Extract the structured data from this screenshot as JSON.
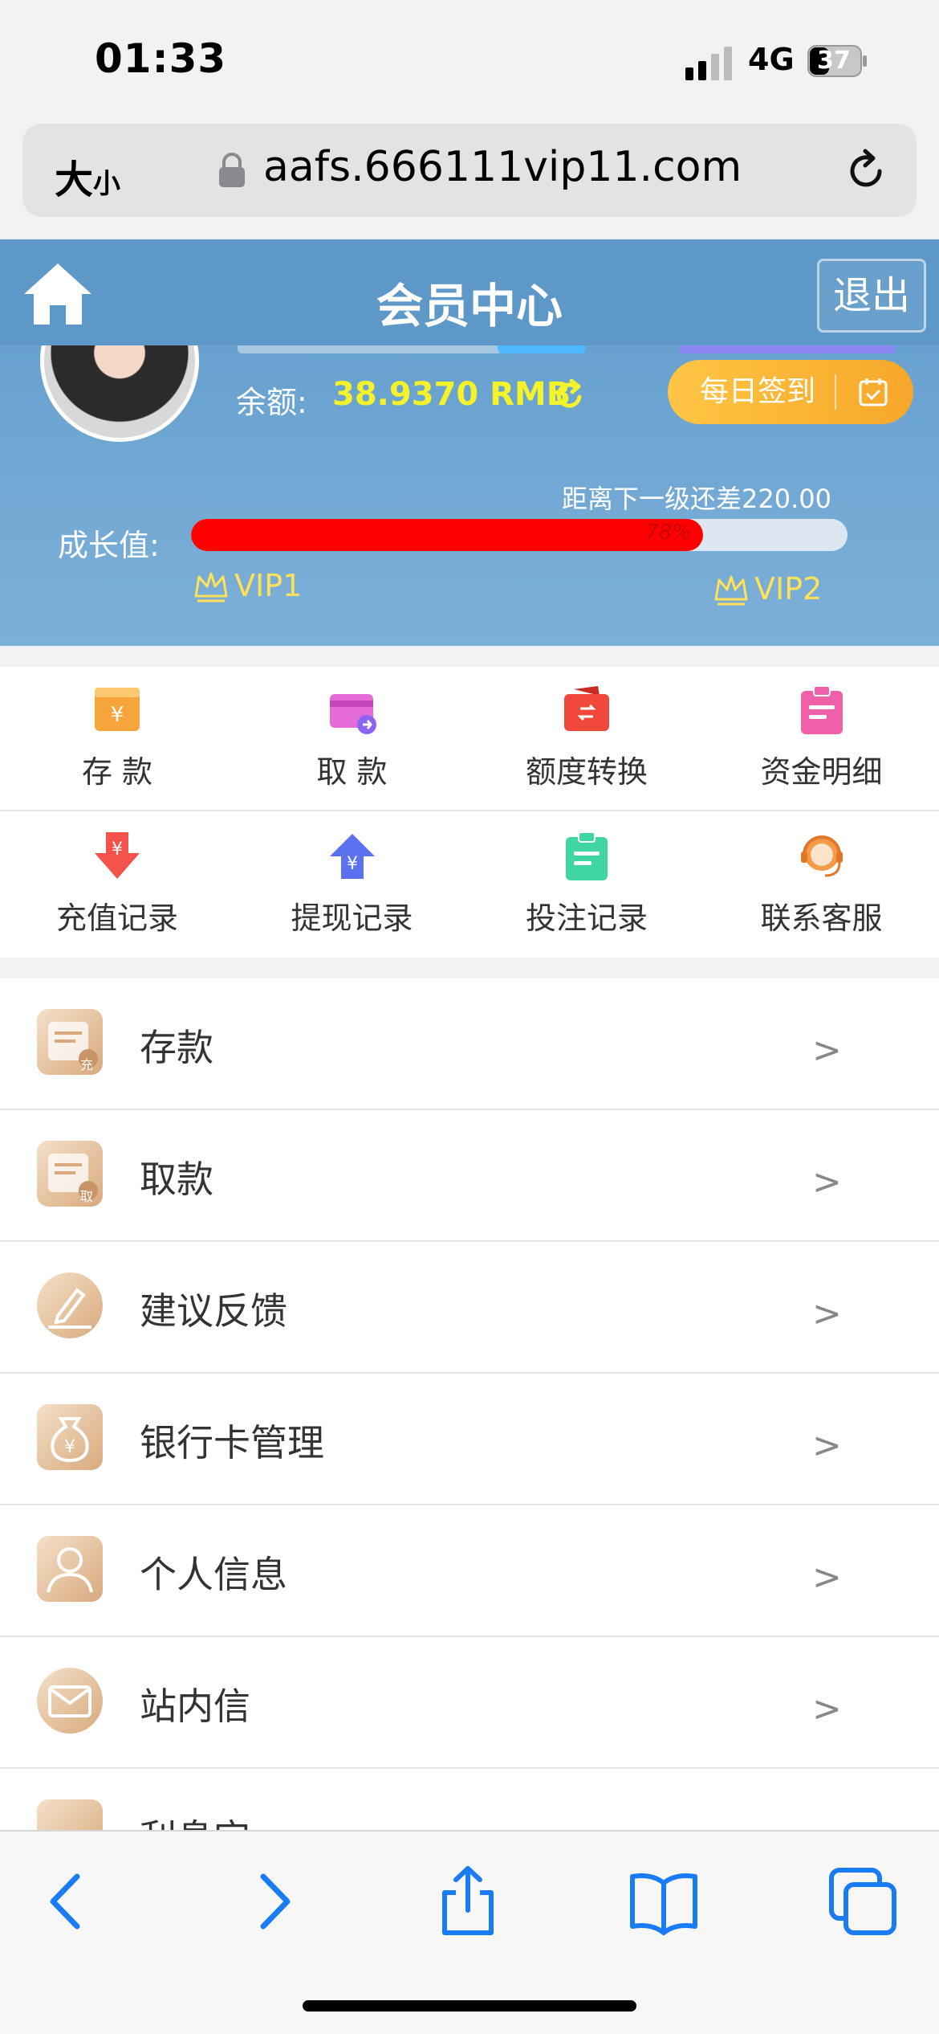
{
  "status_bar": {
    "time": "01:33",
    "network": "4G",
    "battery": "37"
  },
  "address_bar": {
    "text_size_big": "大",
    "text_size_small": "小",
    "url": "aafs.666111vip11.com"
  },
  "header": {
    "title": "会员中心",
    "logout": "退出",
    "balance_label": "余额:",
    "balance_value": "38.9370 RMB",
    "checkin": "每日签到",
    "growth_gap": "距离下一级还差220.00",
    "growth_label": "成长值:",
    "progress_percent": 78,
    "progress_text": "78%",
    "vip_current": "VIP1",
    "vip_next": "VIP2"
  },
  "quick_actions": [
    {
      "label": "存 款",
      "icon": "deposit-icon",
      "color": "#f7a43b"
    },
    {
      "label": "取 款",
      "icon": "withdraw-icon",
      "color": "#e56bd8"
    },
    {
      "label": "额度转换",
      "icon": "transfer-icon",
      "color": "#f0483a"
    },
    {
      "label": "资金明细",
      "icon": "details-icon",
      "color": "#f060a8"
    },
    {
      "label": "充值记录",
      "icon": "recharge-record-icon",
      "color": "#f5524c"
    },
    {
      "label": "提现记录",
      "icon": "withdraw-record-icon",
      "color": "#5b72f0"
    },
    {
      "label": "投注记录",
      "icon": "bet-record-icon",
      "color": "#3fd6a2"
    },
    {
      "label": "联系客服",
      "icon": "support-icon",
      "color": "#f59a48"
    }
  ],
  "menu": [
    {
      "label": "存款",
      "icon": "deposit-menu-icon",
      "badge": "充"
    },
    {
      "label": "取款",
      "icon": "withdraw-menu-icon",
      "badge": "取"
    },
    {
      "label": "建议反馈",
      "icon": "feedback-icon",
      "badge": ""
    },
    {
      "label": "银行卡管理",
      "icon": "bank-card-icon",
      "badge": ""
    },
    {
      "label": "个人信息",
      "icon": "profile-icon",
      "badge": ""
    },
    {
      "label": "站内信",
      "icon": "mail-icon",
      "badge": ""
    },
    {
      "label": "利息宝",
      "icon": "interest-icon",
      "badge": ""
    }
  ],
  "menu_chevron": ">"
}
